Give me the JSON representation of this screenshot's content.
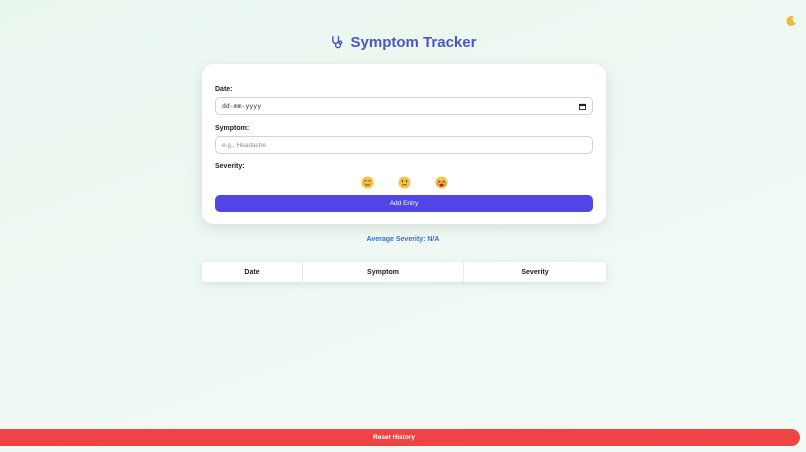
{
  "app": {
    "title": "Symptom Tracker",
    "theme_toggle_icon": "moon-icon"
  },
  "form": {
    "date_label": "Date:",
    "date_value": "dd-mm-yyyy",
    "symptom_label": "Symptom:",
    "symptom_placeholder": "e.g., Headache",
    "severity_label": "Severity:",
    "severity_options": [
      "mild-face-icon",
      "moderate-face-icon",
      "severe-face-icon"
    ],
    "add_button": "Add Entry"
  },
  "summary": {
    "average_severity": "Average Severity: N/A"
  },
  "history_table": {
    "headers": [
      "Date",
      "Symptom",
      "Severity"
    ],
    "rows": []
  },
  "footer": {
    "reset_button": "Reset History"
  },
  "colors": {
    "accent": "#4f46e5",
    "title": "#4b55c9",
    "average_text": "#3b6fd8",
    "danger": "#ef4444"
  }
}
